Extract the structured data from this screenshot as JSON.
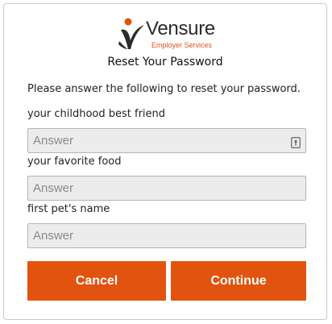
{
  "brand": {
    "name": "Vensure",
    "tagline": "Employer Services",
    "accent_color": "#e2530f",
    "logo_icon": "vensure-swoosh-icon"
  },
  "form": {
    "title": "Reset Your Password",
    "intro": "Please answer the following to reset your password.",
    "questions": [
      {
        "label": "your childhood best friend",
        "value": "",
        "placeholder": "Answer"
      },
      {
        "label": "your favorite food",
        "value": "",
        "placeholder": "Answer"
      },
      {
        "label": "first pet's name",
        "value": "",
        "placeholder": "Answer"
      }
    ],
    "field_icon": "password-key-icon"
  },
  "actions": {
    "cancel_label": "Cancel",
    "continue_label": "Continue"
  }
}
